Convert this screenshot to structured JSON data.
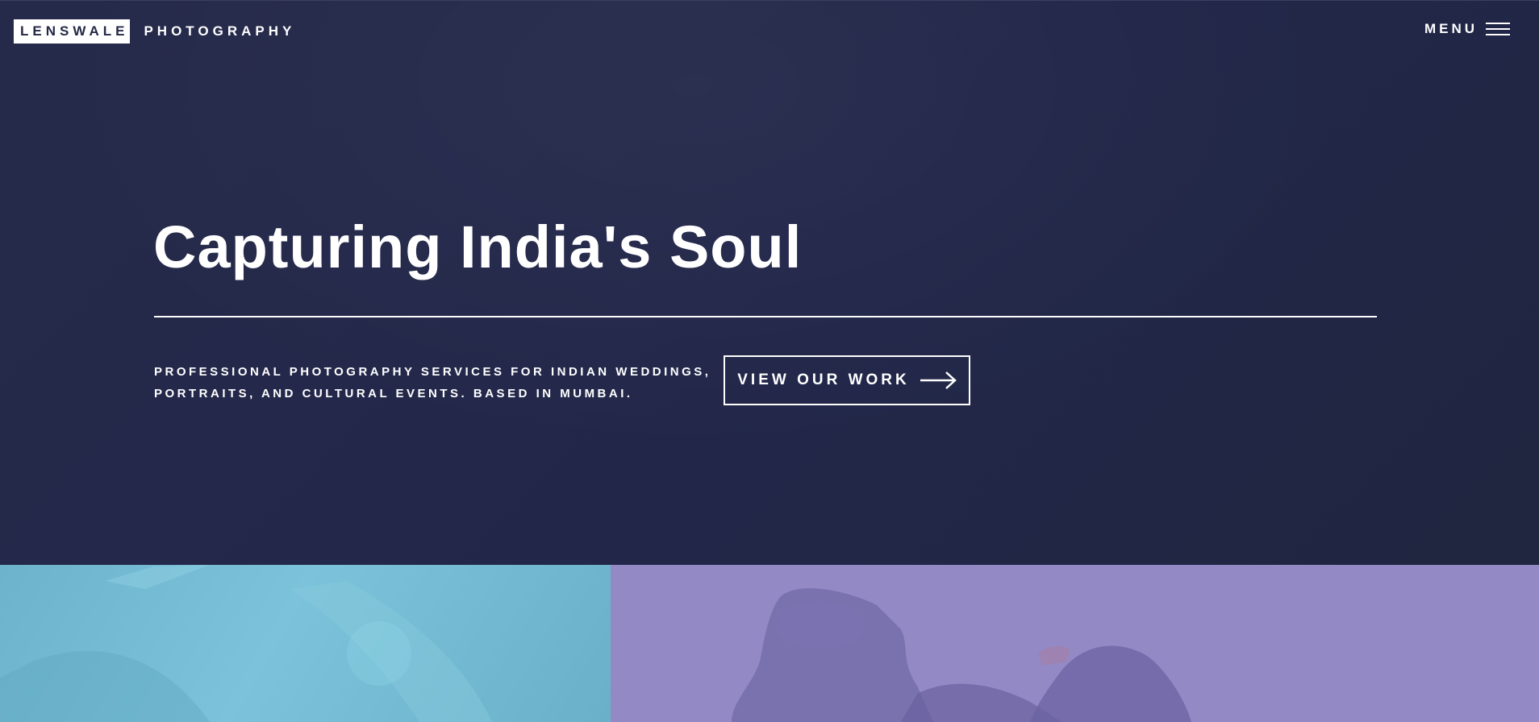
{
  "header": {
    "logo_box_text": "LENSWALE",
    "logo_sub_text": "PHOTOGRAPHY",
    "menu_label": "MENU"
  },
  "hero": {
    "headline": "Capturing India's Soul",
    "tagline_line1": "PROFESSIONAL PHOTOGRAPHY SERVICES FOR INDIAN WEDDINGS,",
    "tagline_line2": "PORTRAITS, AND CULTURAL EVENTS. BASED IN MUMBAI.",
    "cta_label": "VIEW OUR WORK"
  },
  "colors": {
    "hero_background": "#242845",
    "accent": "#ffffff",
    "tile_left": "#74bbd3",
    "tile_right": "#9389c4"
  },
  "icons": {
    "menu": "hamburger-icon",
    "cta": "arrow-right-icon"
  }
}
